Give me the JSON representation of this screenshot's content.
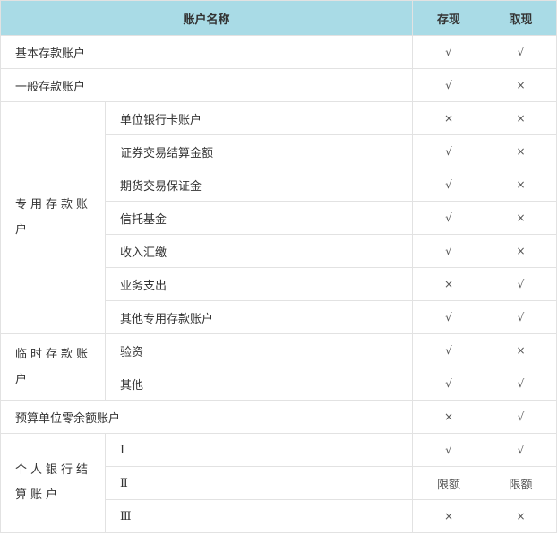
{
  "headers": {
    "name": "账户名称",
    "deposit": "存现",
    "withdraw": "取现"
  },
  "rows": {
    "basic": {
      "label": "基本存款账户",
      "deposit": "√",
      "withdraw": "√"
    },
    "general": {
      "label": "一般存款账户",
      "deposit": "√",
      "withdraw": "×"
    },
    "special": {
      "label": "专用存款账户",
      "subs": [
        {
          "label": "单位银行卡账户",
          "deposit": "×",
          "withdraw": "×"
        },
        {
          "label": "证券交易结算金额",
          "deposit": "√",
          "withdraw": "×"
        },
        {
          "label": "期货交易保证金",
          "deposit": "√",
          "withdraw": "×"
        },
        {
          "label": "信托基金",
          "deposit": "√",
          "withdraw": "×"
        },
        {
          "label": "收入汇缴",
          "deposit": "√",
          "withdraw": "×"
        },
        {
          "label": "业务支出",
          "deposit": "×",
          "withdraw": "√"
        },
        {
          "label": "其他专用存款账户",
          "deposit": "√",
          "withdraw": "√"
        }
      ]
    },
    "temporary": {
      "label": "临时存款账户",
      "subs": [
        {
          "label": "验资",
          "deposit": "√",
          "withdraw": "×"
        },
        {
          "label": "其他",
          "deposit": "√",
          "withdraw": "√"
        }
      ]
    },
    "budget": {
      "label": "预算单位零余额账户",
      "deposit": "×",
      "withdraw": "√"
    },
    "personal": {
      "label": "个人银行结算账户",
      "subs": [
        {
          "label": "Ⅰ",
          "deposit": "√",
          "withdraw": "√"
        },
        {
          "label": "Ⅱ",
          "deposit": "限额",
          "withdraw": "限额"
        },
        {
          "label": "Ⅲ",
          "deposit": "×",
          "withdraw": "×"
        }
      ]
    }
  }
}
